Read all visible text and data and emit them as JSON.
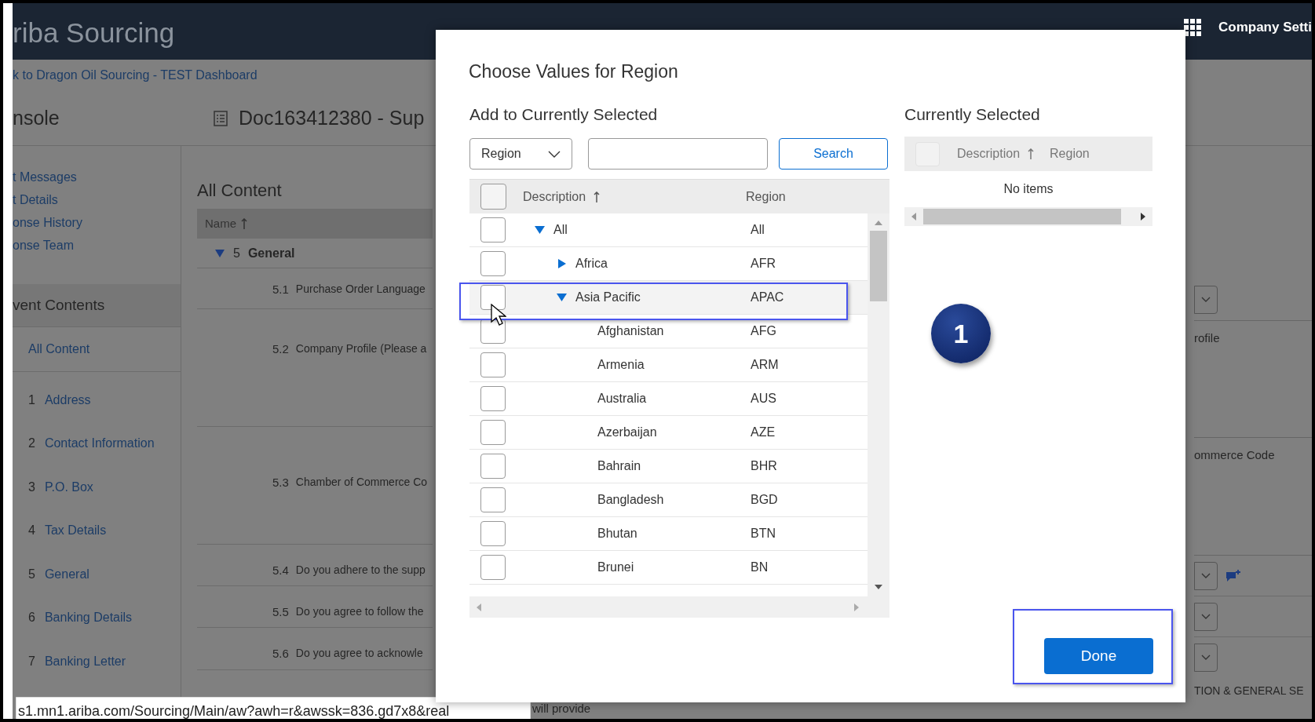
{
  "app_header": {
    "title": "riba Sourcing",
    "company_settings": "Company Setti"
  },
  "back_link": "k to Dragon Oil Sourcing - TEST Dashboard",
  "console_title": "nsole",
  "document_title": "Doc163412380 - Sup",
  "sidebar": {
    "links": [
      "t Messages",
      "t Details",
      "onse History",
      "onse Team"
    ],
    "section_title": "vent Contents",
    "all_content": "All Content",
    "items": [
      {
        "number": "1",
        "label": "Address"
      },
      {
        "number": "2",
        "label": "Contact Information"
      },
      {
        "number": "3",
        "label": "P.O. Box"
      },
      {
        "number": "4",
        "label": "Tax Details"
      },
      {
        "number": "5",
        "label": "General"
      },
      {
        "number": "6",
        "label": "Banking Details"
      },
      {
        "number": "7",
        "label": "Banking Letter"
      }
    ]
  },
  "content": {
    "heading": "All Content",
    "column": "Name",
    "section": {
      "number": "5",
      "label": "General",
      "expanded": true
    },
    "rows": [
      {
        "number": "5.1",
        "label": "Purchase Order Language"
      },
      {
        "number": "5.2",
        "label": "Company Profile (Please a"
      },
      {
        "number": "5.3",
        "label": "Chamber of Commerce Co"
      },
      {
        "number": "5.4",
        "label": "Do you adhere to the supp"
      },
      {
        "number": "5.5",
        "label": "Do you agree to follow the"
      },
      {
        "number": "5.6",
        "label": "Do you agree to acknowle"
      }
    ]
  },
  "right_fragments": {
    "profile": "rofile",
    "commerce": "ommerce Code",
    "section": "TION & GENERAL SE",
    "provide": "will provide"
  },
  "status_url": "s1.mn1.ariba.com/Sourcing/Main/aw?awh=r&awssk=836.gd7x8&real",
  "dialog": {
    "title": "Choose Values for Region",
    "add_section": {
      "heading": "Add to Currently Selected",
      "field_dropdown": "Region",
      "search_button": "Search",
      "select_all": {
        "checked": false
      },
      "columns": [
        "Description",
        "Region"
      ],
      "tree": [
        {
          "label": "All",
          "code": "All",
          "expanded": true,
          "checked": false,
          "selected": false,
          "children": [
            {
              "label": "Africa",
              "code": "AFR",
              "expanded": false,
              "checked": false,
              "selected": false
            },
            {
              "label": "Asia Pacific",
              "code": "APAC",
              "expanded": true,
              "checked": false,
              "selected": true,
              "children": [
                {
                  "label": "Afghanistan",
                  "code": "AFG",
                  "checked": false,
                  "selected": false
                },
                {
                  "label": "Armenia",
                  "code": "ARM",
                  "checked": false,
                  "selected": false
                },
                {
                  "label": "Australia",
                  "code": "AUS",
                  "checked": false,
                  "selected": false
                },
                {
                  "label": "Azerbaijan",
                  "code": "AZE",
                  "checked": false,
                  "selected": false
                },
                {
                  "label": "Bahrain",
                  "code": "BHR",
                  "checked": false,
                  "selected": false
                },
                {
                  "label": "Bangladesh",
                  "code": "BGD",
                  "checked": false,
                  "selected": false
                },
                {
                  "label": "Bhutan",
                  "code": "BTN",
                  "checked": false,
                  "selected": false
                },
                {
                  "label": "Brunei",
                  "code": "BN",
                  "checked": false,
                  "selected": false
                }
              ]
            }
          ]
        }
      ]
    },
    "selected_section": {
      "heading": "Currently Selected",
      "select_all": {
        "checked": false
      },
      "columns": [
        "Description",
        "Region"
      ],
      "empty_text": "No items"
    },
    "step_badge": "1",
    "done_button": "Done"
  }
}
